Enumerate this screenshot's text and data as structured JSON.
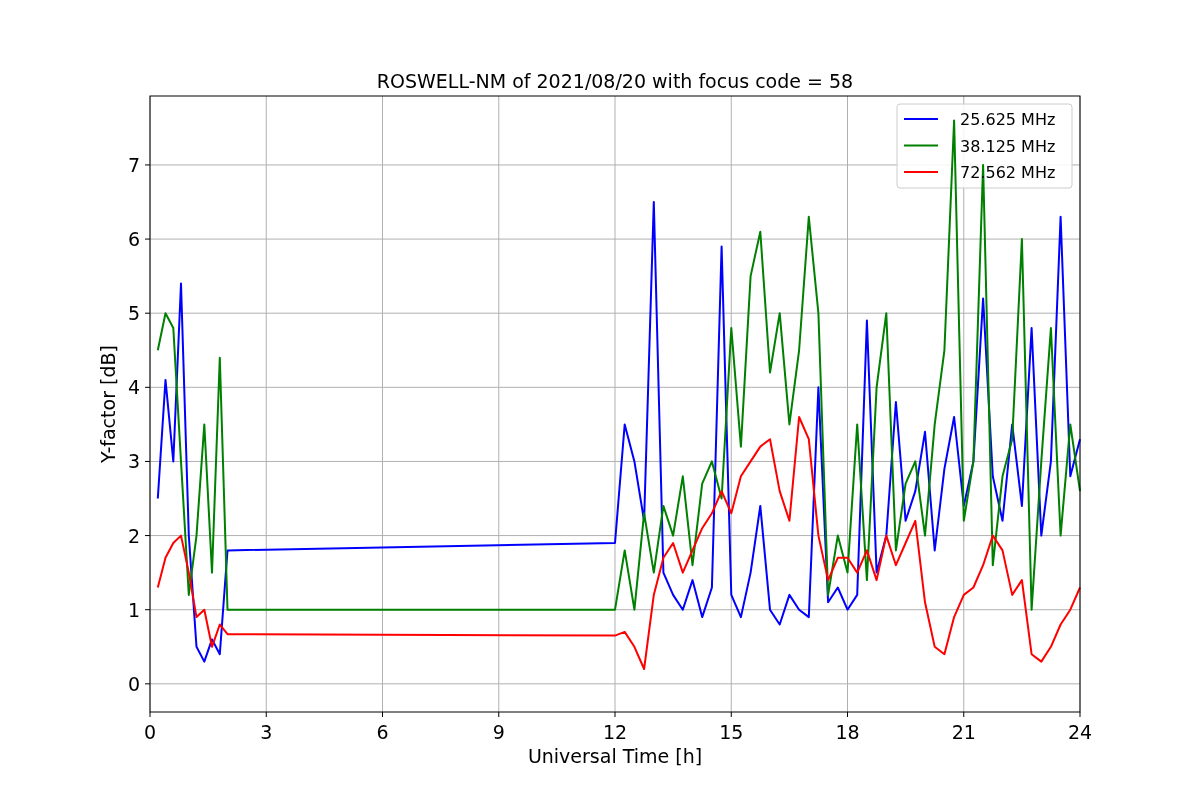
{
  "figure": {
    "chart_data": {
      "type": "line",
      "title": "ROSWELL-NM of 2021/08/20 with focus code = 58",
      "xlabel": "Universal Time [h]",
      "ylabel": "Y-factor [dB]",
      "x": [
        0.2,
        0.4,
        0.6,
        0.8,
        1.0,
        1.2,
        1.4,
        1.6,
        1.8,
        2.0,
        12.0,
        12.25,
        12.5,
        12.75,
        13.0,
        13.25,
        13.5,
        13.75,
        14.0,
        14.25,
        14.5,
        14.75,
        15.0,
        15.25,
        15.5,
        15.75,
        16.0,
        16.25,
        16.5,
        16.75,
        17.0,
        17.25,
        17.5,
        17.75,
        18.0,
        18.25,
        18.5,
        18.75,
        19.0,
        19.25,
        19.5,
        19.75,
        20.0,
        20.25,
        20.5,
        20.75,
        21.0,
        21.25,
        21.5,
        21.75,
        22.0,
        22.25,
        22.5,
        22.75,
        23.0,
        23.25,
        23.5,
        23.75,
        24.0
      ],
      "series": [
        {
          "name": "25.625 MHz",
          "color": "#0000ff",
          "values": [
            2.5,
            4.1,
            3.0,
            5.4,
            2.0,
            0.5,
            0.3,
            0.6,
            0.4,
            1.8,
            1.9,
            3.5,
            3.0,
            2.2,
            6.5,
            1.5,
            1.2,
            1.0,
            1.4,
            0.9,
            1.3,
            5.9,
            1.2,
            0.9,
            1.5,
            2.4,
            1.0,
            0.8,
            1.2,
            1.0,
            0.9,
            4.0,
            1.1,
            1.3,
            1.0,
            1.2,
            4.9,
            1.5,
            2.0,
            3.8,
            2.2,
            2.6,
            3.4,
            1.8,
            2.9,
            3.6,
            2.4,
            3.0,
            5.2,
            2.8,
            2.2,
            3.5,
            2.4,
            4.8,
            2.0,
            3.0,
            6.3,
            2.8,
            3.3
          ]
        },
        {
          "name": "38.125 MHz",
          "color": "#008000",
          "values": [
            4.5,
            5.0,
            4.8,
            3.0,
            1.2,
            2.0,
            3.5,
            1.5,
            4.4,
            1.0,
            1.0,
            1.8,
            1.0,
            2.3,
            1.5,
            2.4,
            2.0,
            2.8,
            1.6,
            2.7,
            3.0,
            2.5,
            4.8,
            3.2,
            5.5,
            6.1,
            4.2,
            5.0,
            3.5,
            4.5,
            6.3,
            5.0,
            1.2,
            2.0,
            1.5,
            3.5,
            1.4,
            4.0,
            5.0,
            1.8,
            2.7,
            3.0,
            2.0,
            3.5,
            4.5,
            7.6,
            2.2,
            3.0,
            7.0,
            1.6,
            2.8,
            3.3,
            6.0,
            1.0,
            3.0,
            4.8,
            2.0,
            3.5,
            2.6
          ]
        },
        {
          "name": "72.562 MHz",
          "color": "#ff0000",
          "values": [
            1.3,
            1.7,
            1.9,
            2.0,
            1.5,
            0.9,
            1.0,
            0.5,
            0.8,
            0.67,
            0.65,
            0.7,
            0.5,
            0.2,
            1.2,
            1.7,
            1.9,
            1.5,
            1.8,
            2.1,
            2.3,
            2.6,
            2.3,
            2.8,
            3.0,
            3.2,
            3.3,
            2.6,
            2.2,
            3.6,
            3.3,
            2.0,
            1.4,
            1.7,
            1.7,
            1.5,
            1.8,
            1.4,
            2.0,
            1.6,
            1.9,
            2.2,
            1.1,
            0.5,
            0.4,
            0.9,
            1.2,
            1.3,
            1.6,
            2.0,
            1.8,
            1.2,
            1.4,
            0.4,
            0.3,
            0.5,
            0.8,
            1.0,
            1.3
          ]
        }
      ],
      "xlim": [
        0,
        24
      ],
      "ylim": [
        -0.38,
        7.93
      ],
      "xticks": [
        0,
        3,
        6,
        9,
        12,
        15,
        18,
        21,
        24
      ],
      "yticks": [
        0,
        1,
        2,
        3,
        4,
        5,
        6,
        7
      ],
      "grid": true,
      "legend": true
    }
  }
}
